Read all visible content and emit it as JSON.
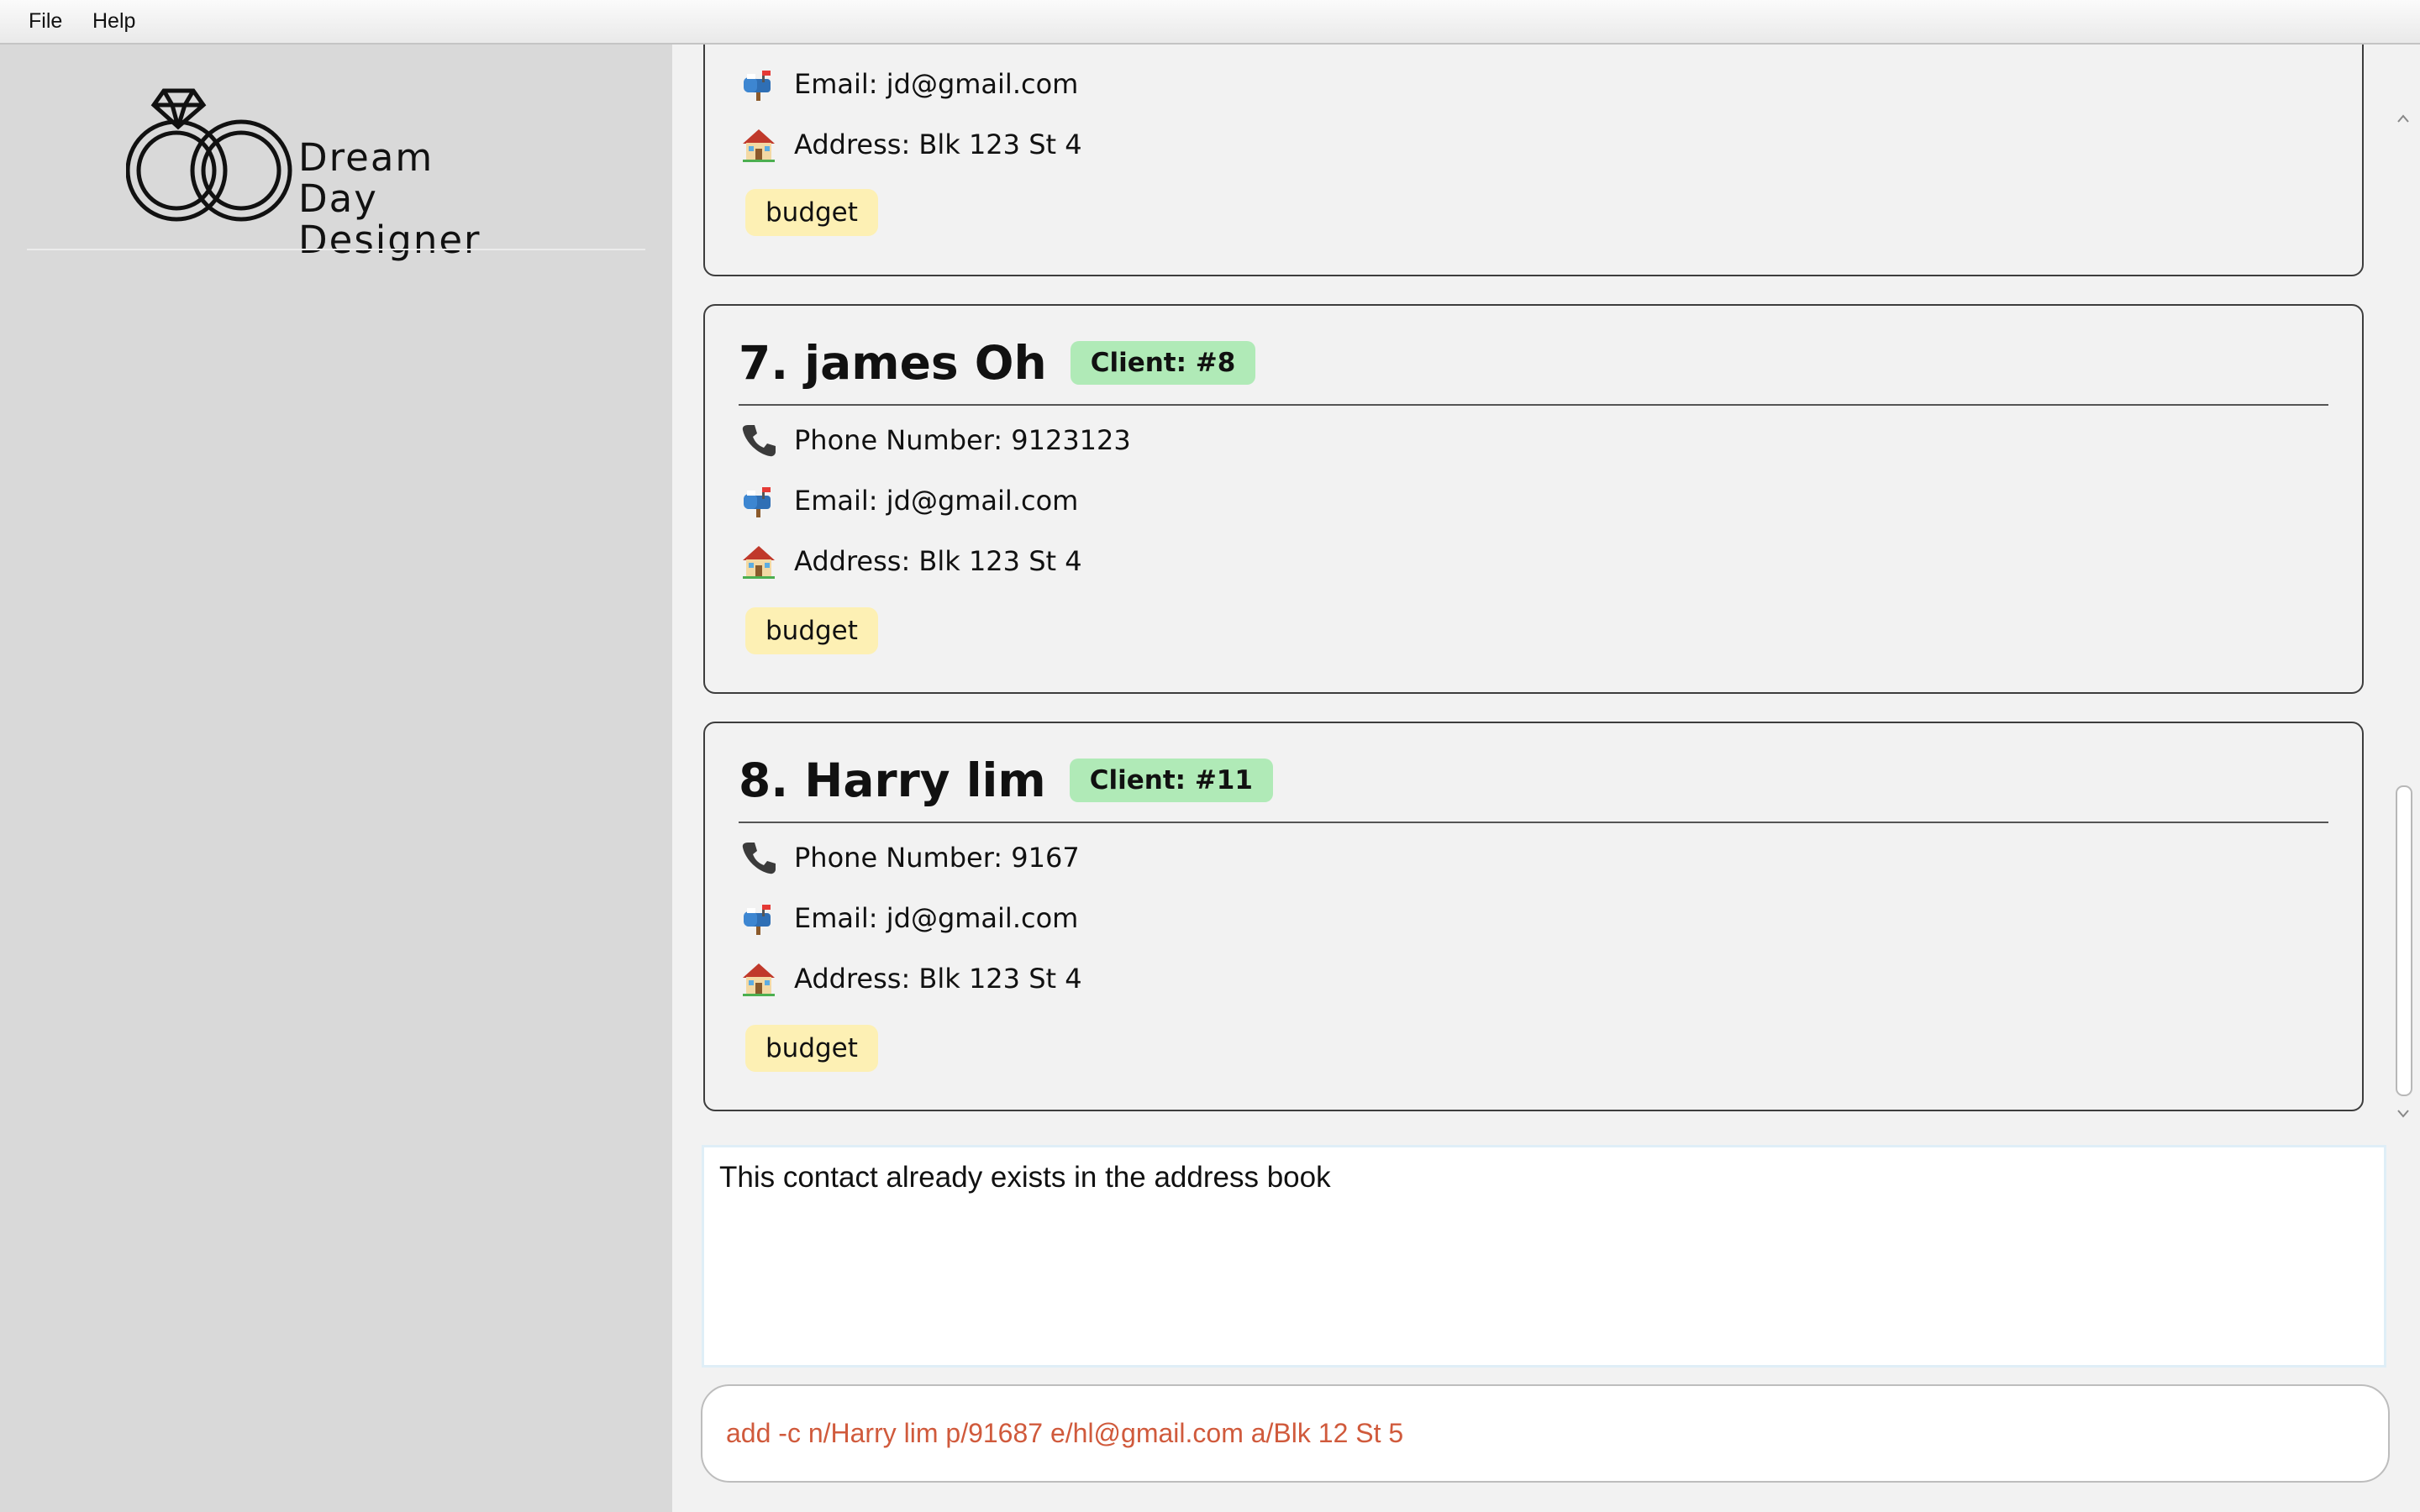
{
  "menu": {
    "file_label": "File",
    "help_label": "Help"
  },
  "logo": {
    "line1": "Dream",
    "line2": "Day",
    "line3": "Designer"
  },
  "contacts": [
    {
      "email": "Email: jd@gmail.com",
      "address": "Address: Blk 123 St 4",
      "tag": "budget"
    },
    {
      "name": "7. james Oh",
      "client_badge": "Client: #8",
      "phone": "Phone Number: 9123123",
      "email": "Email: jd@gmail.com",
      "address": "Address: Blk 123 St 4",
      "tag": "budget"
    },
    {
      "name": "8. Harry lim",
      "client_badge": "Client: #11",
      "phone": "Phone Number: 9167",
      "email": "Email: jd@gmail.com",
      "address": "Address: Blk 123 St 4",
      "tag": "budget"
    }
  ],
  "icons": {
    "phone": "phone-icon",
    "email": "mailbox-icon",
    "address": "house-icon"
  },
  "result": {
    "message": "This contact already exists in the address book"
  },
  "command": {
    "value": "add -c n/Harry lim p/91687 e/hl@gmail.com a/Blk 12 St 5"
  },
  "colors": {
    "client_badge": "#b0eab7",
    "tag": "#fdf0b4",
    "command_text_error": "#d05a3c"
  }
}
